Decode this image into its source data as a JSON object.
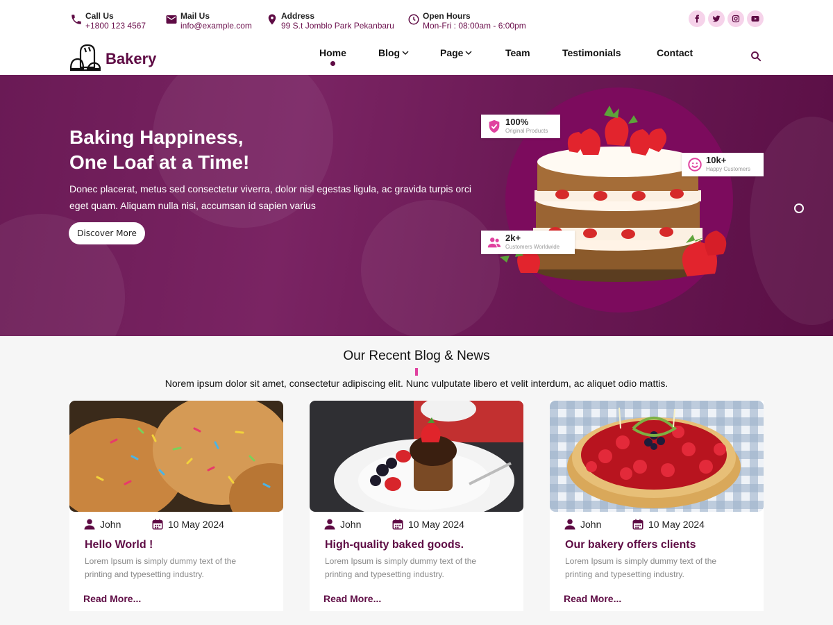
{
  "topbar": {
    "call": {
      "label": "Call Us",
      "value": "+1800 123 4567",
      "icon": "phone-icon"
    },
    "mail": {
      "label": "Mail Us",
      "value": "info@example.com",
      "icon": "mail-icon"
    },
    "address": {
      "label": "Address",
      "value": "99 S.t Jomblo Park Pekanbaru",
      "icon": "map-pin-icon"
    },
    "hours": {
      "label": "Open Hours",
      "value": "Mon-Fri : 08:00am - 6:00pm",
      "icon": "clock-icon"
    },
    "socials": [
      "facebook-icon",
      "twitter-icon",
      "instagram-icon",
      "youtube-icon"
    ]
  },
  "nav": {
    "logo_text": "Bakery",
    "items": [
      {
        "label": "Home",
        "active": true
      },
      {
        "label": "Blog",
        "dropdown": true
      },
      {
        "label": "Page",
        "dropdown": true
      },
      {
        "label": "Team"
      },
      {
        "label": "Testimonials"
      },
      {
        "label": "Contact"
      }
    ]
  },
  "hero": {
    "title_line1": "Baking Happiness,",
    "title_line2": "One Loaf at a Time!",
    "text": "Donec placerat, metus sed consectetur viverra, dolor nisl egestas ligula, ac gravida turpis orci eget quam. Aliquam nulla nisi, accumsan id sapien varius",
    "button": "Discover More",
    "badges": [
      {
        "value": "100%",
        "label": "Original Products",
        "icon": "shield-check-icon"
      },
      {
        "value": "10k+",
        "label": "Happy Customers",
        "icon": "smile-icon"
      },
      {
        "value": "2k+",
        "label": "Customers Worldwide",
        "icon": "users-icon"
      }
    ]
  },
  "blog": {
    "heading": "Our Recent Blog & News",
    "subtitle": "Norem ipsum dolor sit amet, consectetur adipiscing elit. Nunc vulputate libero et velit interdum, ac aliquet odio mattis.",
    "posts": [
      {
        "author": "John",
        "date": "10 May 2024",
        "title": "Hello World !",
        "excerpt": "Lorem Ipsum is simply dummy text of  the printing and typesetting industry.",
        "link": "Read More..."
      },
      {
        "author": "John",
        "date": "10 May 2024",
        "title": "High-quality baked goods.",
        "excerpt": "Lorem Ipsum is simply dummy text of  the printing and typesetting industry.",
        "link": "Read More..."
      },
      {
        "author": "John",
        "date": "10 May 2024",
        "title": "Our bakery offers clients",
        "excerpt": "Lorem Ipsum is simply dummy text of  the printing and typesetting industry.",
        "link": "Read More..."
      }
    ]
  },
  "colors": {
    "brand": "#5e0b44",
    "accent": "#e0429f",
    "hero_bg": "#6a1a55"
  }
}
